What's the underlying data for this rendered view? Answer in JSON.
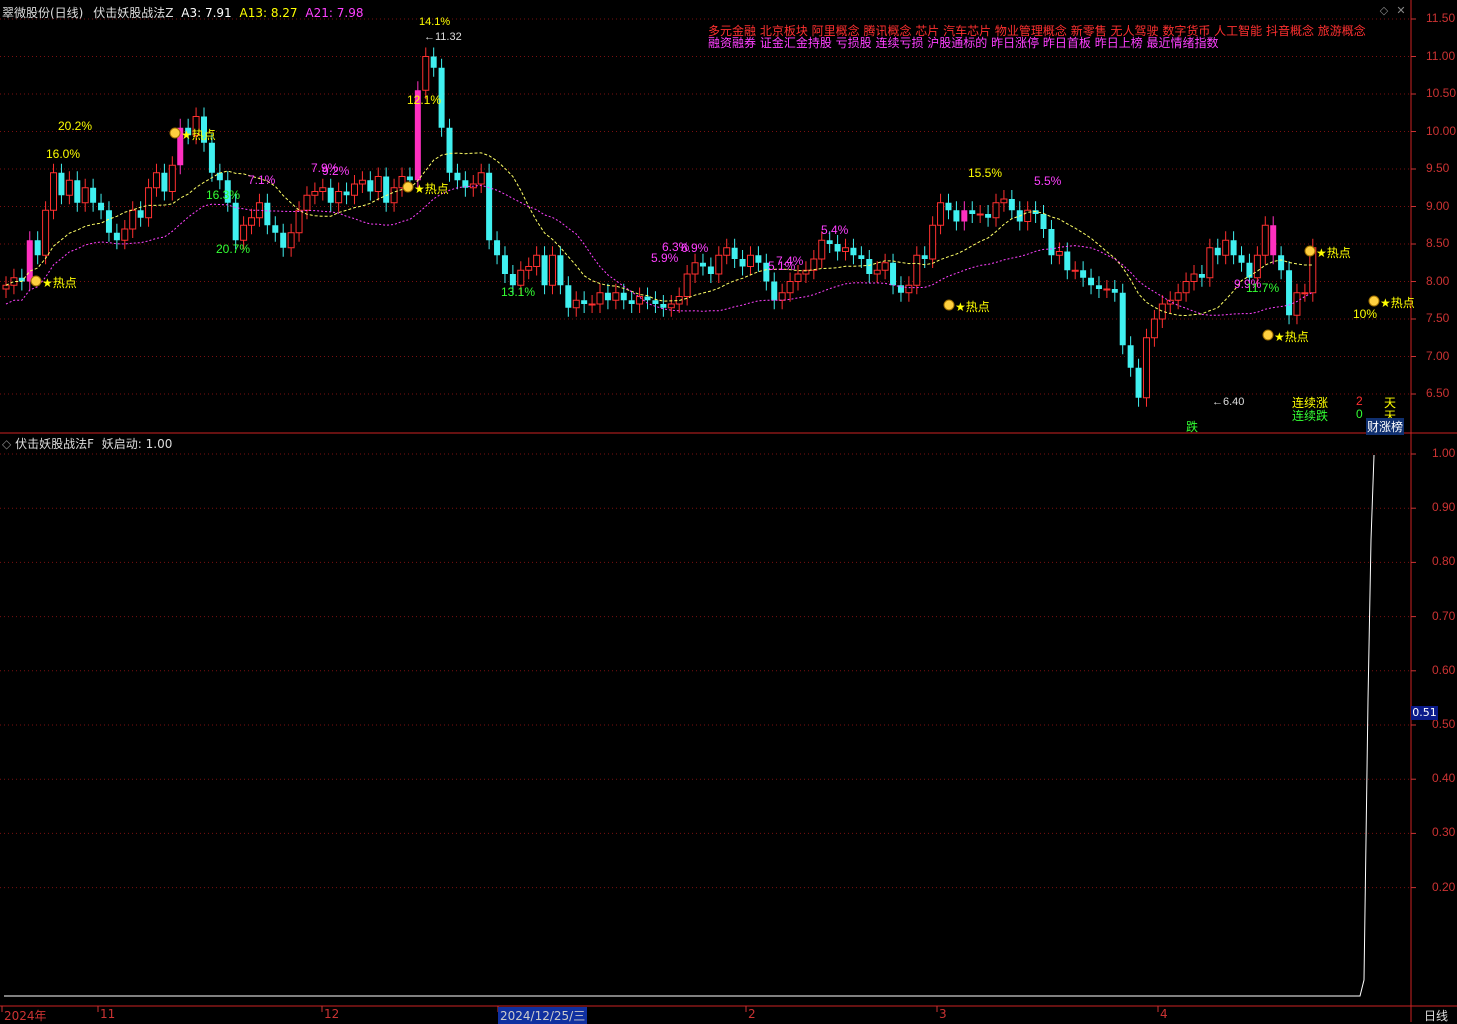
{
  "main_header": {
    "stock_name": "翠微股份(日线)",
    "indicator": "伏击妖股战法Z",
    "a3": "A3: 7.91",
    "a13": "A13: 8.27",
    "a21": "A21: 7.98",
    "colors": {
      "a3": "#ffffff",
      "a13": "#ffff00",
      "a21": "#ff40ff"
    }
  },
  "sub_header": {
    "indicator": "伏击妖股战法F",
    "value": "妖启动: 1.00"
  },
  "concepts": {
    "line1": "多元金融    北京板块    阿里概念 腾讯概念 芯片 汽车芯片 物业管理概念 新零售 无人驾驶 数字货币 人工智能 抖音概念 旅游概念",
    "line2": "融资融券 证金汇金持股 亏损股 连续亏损 沪股通标的 昨日涨停 昨日首板 昨日上榜 最近情绪指数"
  },
  "price_axis": [
    "11.50",
    "11.00",
    "10.50",
    "10.00",
    "9.50",
    "9.00",
    "8.50",
    "8.00",
    "7.50",
    "7.00",
    "6.50"
  ],
  "sub_axis": [
    "1.00",
    "0.90",
    "0.80",
    "0.70",
    "0.60",
    "0.50",
    "0.40",
    "0.30",
    "0.20"
  ],
  "sub_axis_marker": "0.51",
  "date_axis": [
    {
      "label": "2024年"
    },
    {
      "label": "11"
    },
    {
      "label": "12"
    },
    {
      "label": "2024/12/25/三",
      "highlight": true
    },
    {
      "label": "2"
    },
    {
      "label": "3"
    },
    {
      "label": "4"
    }
  ],
  "period_label": "日线",
  "high_mark": "11.32",
  "high_pct": "14.1%",
  "low_mark": "6.40",
  "streak": {
    "up_label": "连续涨",
    "up_value": "2",
    "up_unit": "天",
    "down_label": "连续跌",
    "down_value": "0",
    "down_unit": "天"
  },
  "fall_tag": "跌",
  "rank_tag": "财涨榜",
  "hot_label": "热点",
  "pct_labels": [
    {
      "text": "20.2%",
      "color": "#ffff00"
    },
    {
      "text": "16.0%",
      "color": "#ffff00"
    },
    {
      "text": "16.3%",
      "color": "#33ff33"
    },
    {
      "text": "20.7%",
      "color": "#33ff33"
    },
    {
      "text": "7.1%",
      "color": "#ff40ff"
    },
    {
      "text": "7.9%",
      "color": "#ff40ff"
    },
    {
      "text": "9.2%",
      "color": "#ff40ff"
    },
    {
      "text": "12.1%",
      "color": "#ffff00"
    },
    {
      "text": "13.1%",
      "color": "#33ff33"
    },
    {
      "text": "5.9%",
      "color": "#ff40ff"
    },
    {
      "text": "6.3%",
      "color": "#ff40ff"
    },
    {
      "text": "6.9%",
      "color": "#ff40ff"
    },
    {
      "text": "5.1%",
      "color": "#ff40ff"
    },
    {
      "text": "7.4%",
      "color": "#ff40ff"
    },
    {
      "text": "5.4%",
      "color": "#ff40ff"
    },
    {
      "text": "15.5%",
      "color": "#ffff00"
    },
    {
      "text": "5.5%",
      "color": "#ff40ff"
    },
    {
      "text": "9.9%",
      "color": "#ff40ff"
    },
    {
      "text": "11.7%",
      "color": "#33ff33"
    },
    {
      "text": "10%",
      "color": "#ffff00"
    }
  ],
  "colors": {
    "up": "#ff3030",
    "down": "#40f0f0",
    "limit": "#ff30c0",
    "grid": "#7a1010",
    "axis": "#cc3333"
  }
}
